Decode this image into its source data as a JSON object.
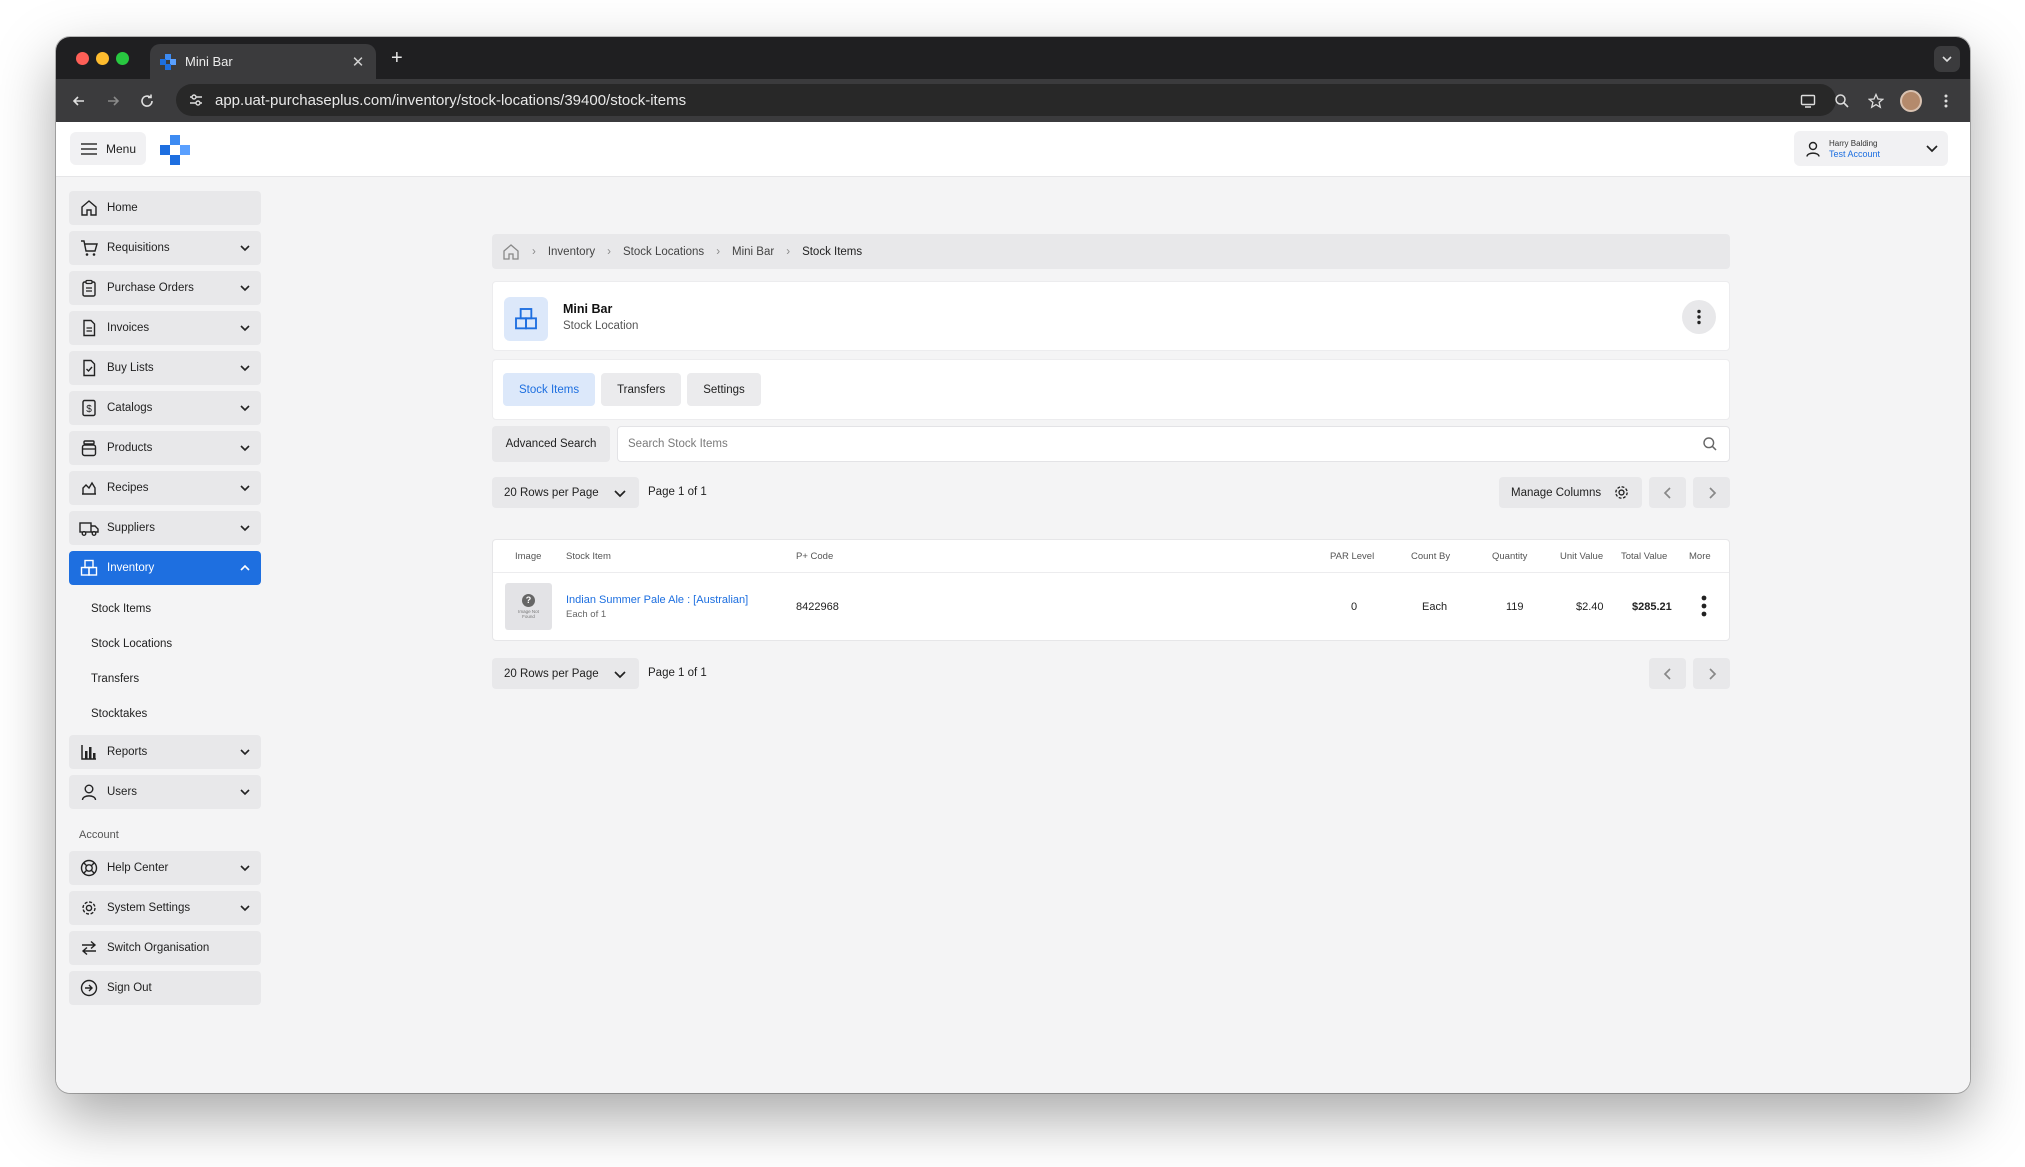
{
  "browser": {
    "tab_title": "Mini Bar",
    "url": "app.uat-purchaseplus.com/inventory/stock-locations/39400/stock-items"
  },
  "appbar": {
    "menu_label": "Menu",
    "user_name": "Harry Balding",
    "user_account": "Test Account"
  },
  "sidebar": {
    "items": [
      {
        "label": "Home",
        "icon": "home-icon"
      },
      {
        "label": "Requisitions",
        "icon": "cart-icon"
      },
      {
        "label": "Purchase Orders",
        "icon": "clipboard-icon"
      },
      {
        "label": "Invoices",
        "icon": "document-icon"
      },
      {
        "label": "Buy Lists",
        "icon": "checklist-icon"
      },
      {
        "label": "Catalogs",
        "icon": "dollar-doc-icon"
      },
      {
        "label": "Products",
        "icon": "jar-icon"
      },
      {
        "label": "Recipes",
        "icon": "recipe-icon"
      },
      {
        "label": "Suppliers",
        "icon": "truck-icon"
      },
      {
        "label": "Inventory",
        "icon": "boxes-icon"
      }
    ],
    "inventory_sub": [
      "Stock Items",
      "Stock Locations",
      "Transfers",
      "Stocktakes"
    ],
    "more_items": [
      {
        "label": "Reports",
        "icon": "bar-chart-icon"
      },
      {
        "label": "Users",
        "icon": "user-icon"
      }
    ],
    "account_label": "Account",
    "account_items": [
      {
        "label": "Help Center",
        "icon": "lifebuoy-icon"
      },
      {
        "label": "System Settings",
        "icon": "gear-icon"
      },
      {
        "label": "Switch Organisation",
        "icon": "switch-icon"
      },
      {
        "label": "Sign Out",
        "icon": "sign-out-icon"
      }
    ]
  },
  "breadcrumb": [
    "Inventory",
    "Stock Locations",
    "Mini Bar",
    "Stock Items"
  ],
  "location": {
    "title": "Mini Bar",
    "subtitle": "Stock Location"
  },
  "tabs": [
    "Stock Items",
    "Transfers",
    "Settings"
  ],
  "search": {
    "advanced_label": "Advanced Search",
    "placeholder": "Search Stock Items"
  },
  "pagination": {
    "rows_per_page": "20 Rows per Page",
    "page_info": "Page 1 of 1",
    "manage_columns": "Manage Columns"
  },
  "table": {
    "columns": [
      "Image",
      "Stock Item",
      "P+ Code",
      "PAR Level",
      "Count By",
      "Quantity",
      "Unit Value",
      "Total Value",
      "More"
    ],
    "rows": [
      {
        "image_text": "Image Not Found",
        "name": "Indian Summer Pale Ale : [Australian]",
        "pack": "Each of 1",
        "code": "8422968",
        "par_level": "0",
        "count_by": "Each",
        "quantity": "119",
        "unit_value": "$2.40",
        "total_value": "$285.21"
      }
    ]
  },
  "colors": {
    "accent": "#1e6fe0",
    "accent_light": "#dce8fa"
  }
}
